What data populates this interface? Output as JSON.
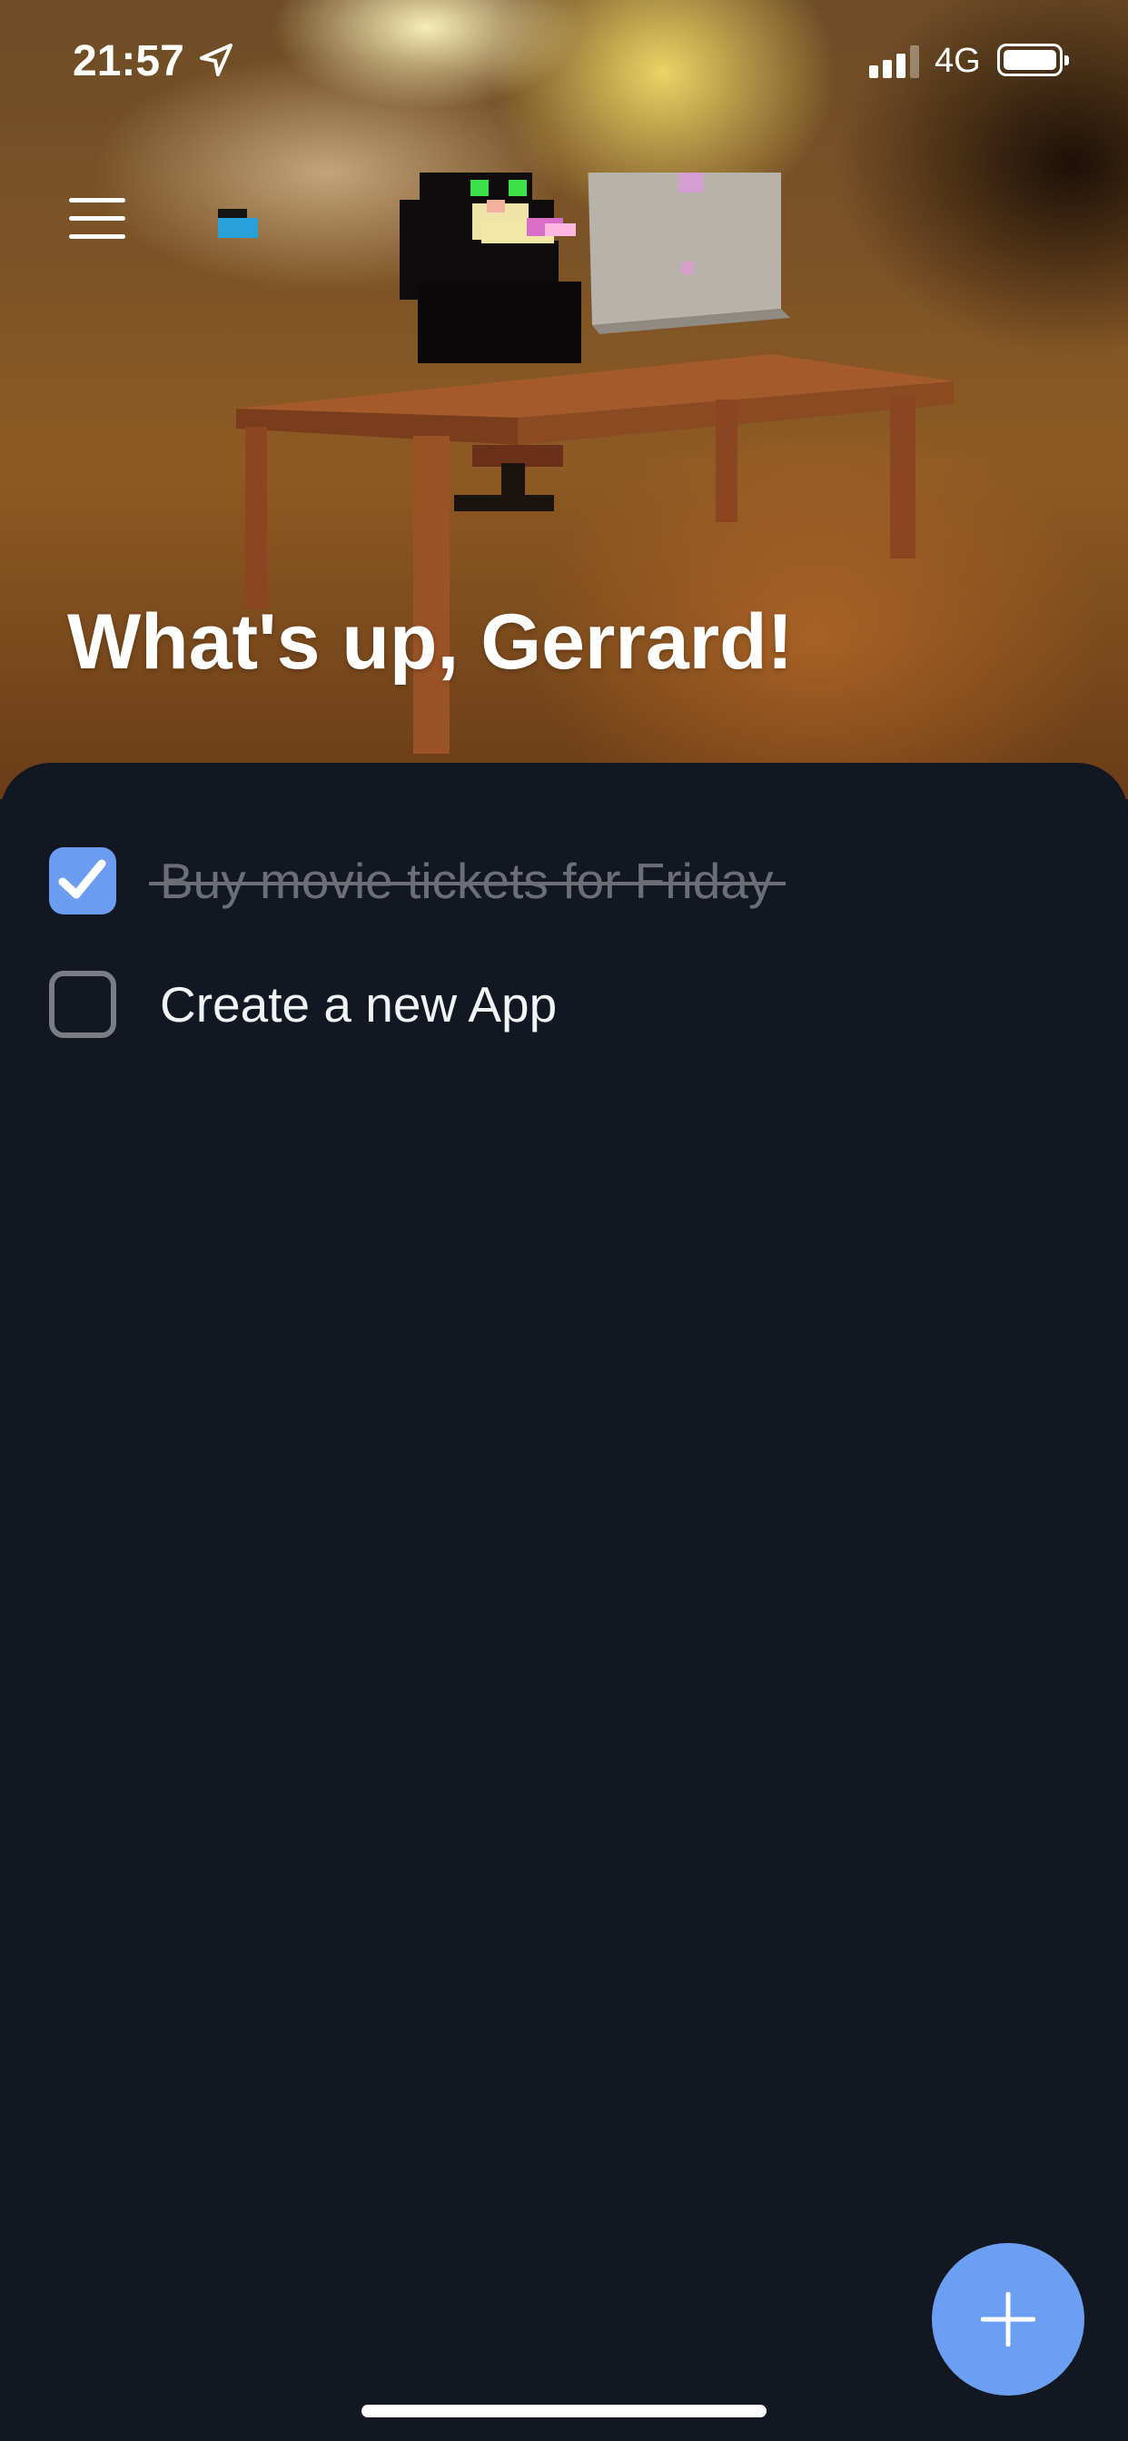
{
  "status_bar": {
    "time": "21:57",
    "network": "4G"
  },
  "header": {
    "greeting": "What's up, Gerrard!"
  },
  "tasks": [
    {
      "label": "Buy movie tickets for Friday",
      "completed": true
    },
    {
      "label": "Create a new App",
      "completed": false
    }
  ],
  "colors": {
    "accent": "#6b9cf0",
    "background": "#131722"
  },
  "icons": {
    "menu": "hamburger-menu-icon",
    "add": "plus-icon",
    "checked": "checkmark-icon",
    "location": "location-arrow-icon"
  }
}
